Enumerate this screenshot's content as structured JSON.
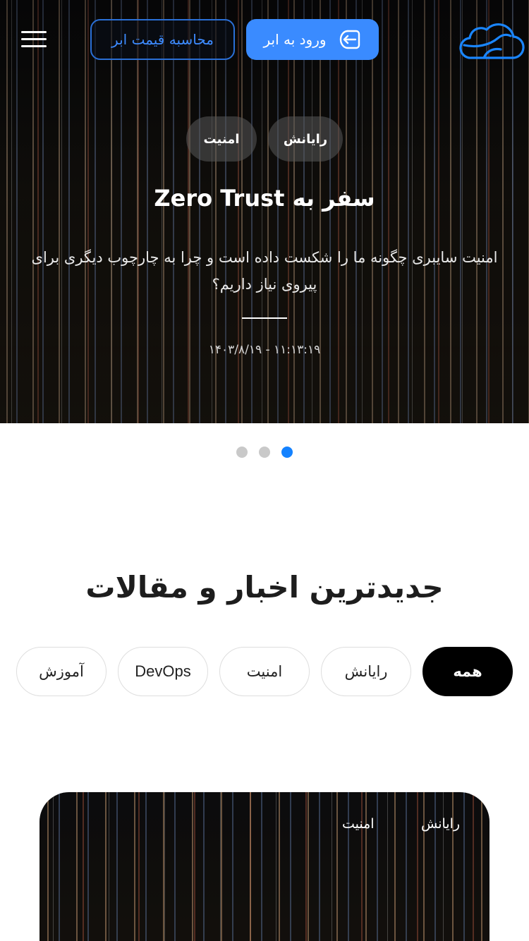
{
  "header": {
    "login_label": "ورود به ابر",
    "calc_label": "محاسبه قیمت ابر",
    "logo_icon": "cloud-logo-icon",
    "menu_icon": "hamburger-menu-icon",
    "login_icon": "login-arrow-icon",
    "accent_color": "#3a8bff"
  },
  "hero": {
    "chips": [
      "رایانش",
      "امنیت"
    ],
    "title": "سفر به Zero Trust",
    "subtitle": "امنیت سایبری چگونه ما را شکست داده است و چرا به چارچوب دیگری برای پیروی نیاز داریم؟",
    "date": "۱۴۰۳/۸/۱۹ - ۱۱:۱۳:۱۹"
  },
  "carousel": {
    "total_slides": 3,
    "active_index": 3,
    "active_color": "#1482ff",
    "inactive_color": "#c9c9c9"
  },
  "news": {
    "title": "جدیدترین اخبار و مقالات",
    "filters": [
      "همه",
      "رایانش",
      "امنیت",
      "DevOps",
      "آموزش"
    ],
    "active_filter": "همه"
  },
  "card": {
    "tags": [
      "رایانش",
      "امنیت"
    ]
  }
}
